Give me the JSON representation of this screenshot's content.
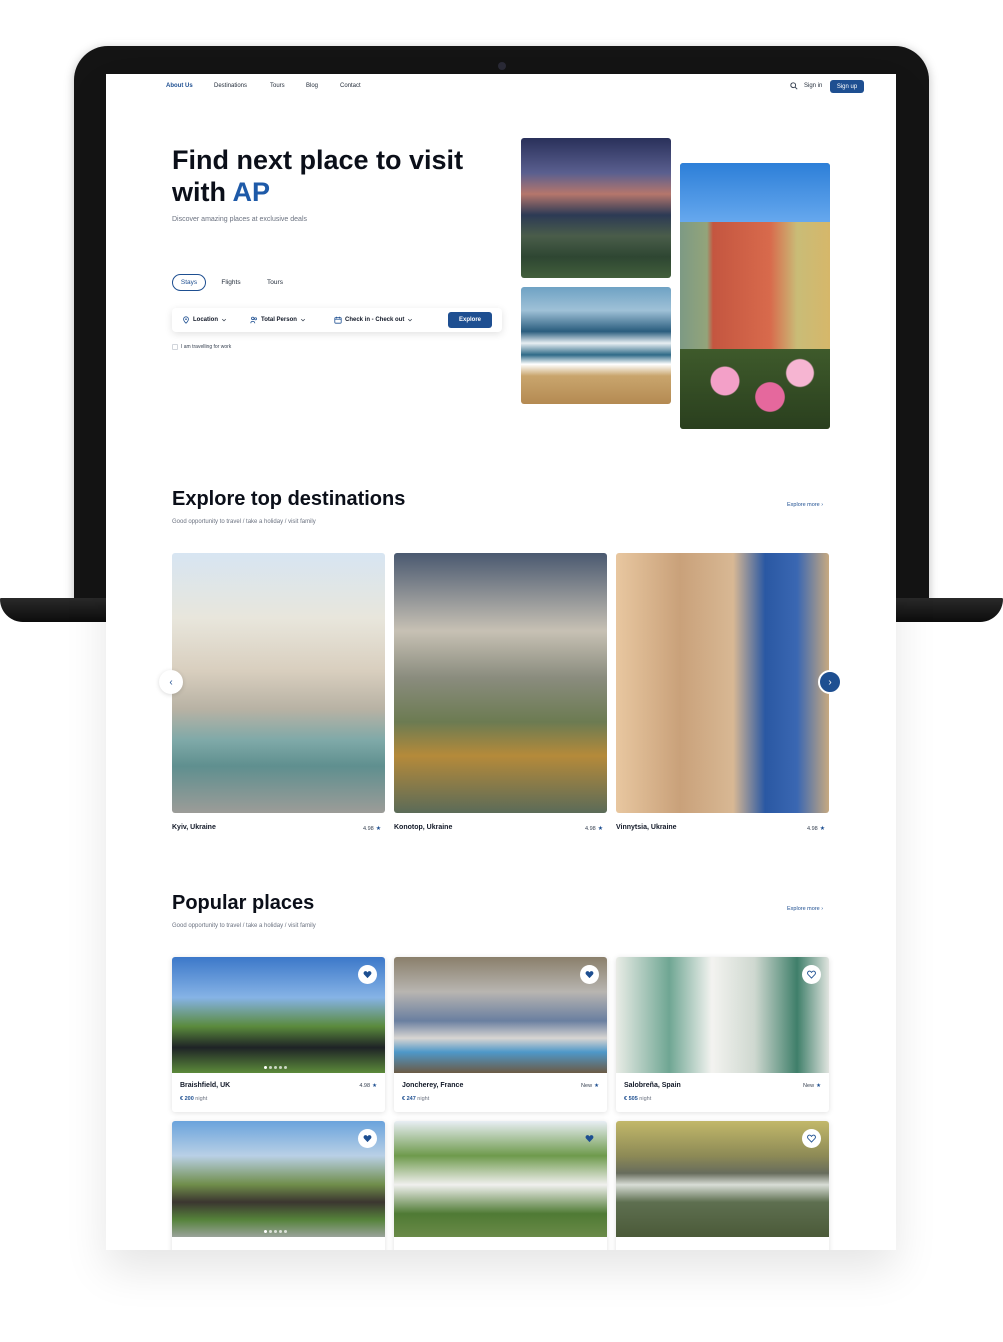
{
  "nav": {
    "links": [
      "About Us",
      "Destinations",
      "Tours",
      "Blog",
      "Contact"
    ],
    "sign_in": "Sign in",
    "sign_up": "Sign up"
  },
  "hero": {
    "title_line1": "Find next place to visit",
    "title_line2_prefix": "with ",
    "title_accent": "AP",
    "subtitle": "Discover amazing places at exclusive deals",
    "tabs": [
      "Stays",
      "Flights",
      "Tours"
    ],
    "search": {
      "location": "Location",
      "total_person": "Total Person",
      "dates": "Check in - Check out",
      "explore": "Explore"
    },
    "work_checkbox": "I am travelling for work"
  },
  "destinations": {
    "title": "Explore top destinations",
    "subtitle": "Good opportunity to travel / take a holiday / visit family",
    "explore_more": "Explore more",
    "items": [
      {
        "name": "Kyiv, Ukraine",
        "rating": "4.98"
      },
      {
        "name": "Konotop, Ukraine",
        "rating": "4.98"
      },
      {
        "name": "Vinnytsia, Ukraine",
        "rating": "4.98"
      }
    ]
  },
  "popular": {
    "title": "Popular places",
    "subtitle": "Good opportunity to travel / take a holiday / visit family",
    "explore_more": "Explore more",
    "items": [
      {
        "name": "Braishfield, UK",
        "rating": "4.98",
        "price": "€ 200",
        "unit": "night",
        "favorite": true
      },
      {
        "name": "Joncherey, France",
        "rating": "New",
        "price": "€ 247",
        "unit": "night",
        "favorite": true
      },
      {
        "name": "Salobreña, Spain",
        "rating": "New",
        "price": "€ 505",
        "unit": "night",
        "favorite": false
      },
      {
        "favorite": true
      },
      {
        "favorite": true
      },
      {
        "favorite": false
      }
    ]
  },
  "colors": {
    "accent": "#1e4f91",
    "hero_accent": "#1e5aa8"
  }
}
